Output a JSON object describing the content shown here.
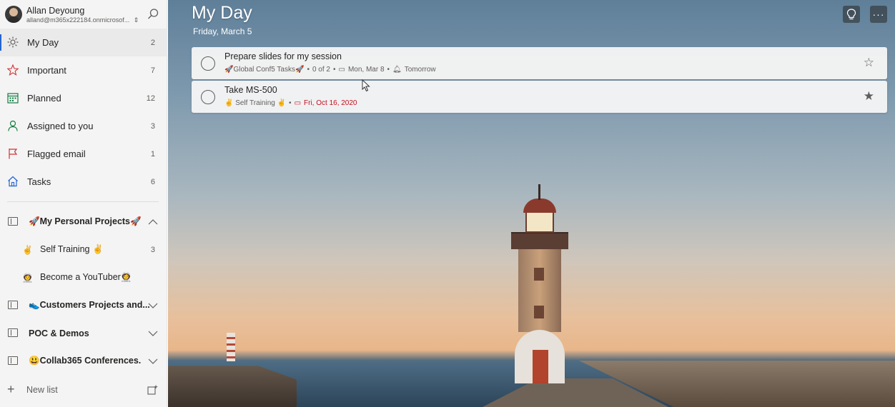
{
  "user": {
    "name": "Allan Deyoung",
    "email": "alland@m365x222184.onmicrosof..."
  },
  "nav": [
    {
      "label": "My Day",
      "count": "2",
      "icon": "sun-icon",
      "color": "#605e5c"
    },
    {
      "label": "Important",
      "count": "7",
      "icon": "star-icon",
      "color": "#d13438"
    },
    {
      "label": "Planned",
      "count": "12",
      "icon": "calendar-icon",
      "color": "#107c41"
    },
    {
      "label": "Assigned to you",
      "count": "3",
      "icon": "person-icon",
      "color": "#107c41"
    },
    {
      "label": "Flagged email",
      "count": "1",
      "icon": "flag-icon",
      "color": "#d13438"
    },
    {
      "label": "Tasks",
      "count": "6",
      "icon": "home-icon",
      "color": "#2564cf"
    }
  ],
  "groups": {
    "personal": {
      "label": "🚀My Personal Projects🚀",
      "lists": [
        {
          "icon": "✌",
          "label": "Self Training ✌",
          "count": "3"
        },
        {
          "icon": "👩‍🚀",
          "label": "Become a YouTuber👩‍🚀",
          "count": ""
        }
      ]
    },
    "customers": {
      "label": "👟Customers Projects and..."
    },
    "poc": {
      "label": "POC & Demos"
    },
    "collab": {
      "label": "😃Collab365 Conferences."
    }
  },
  "new_list_label": "New list",
  "main": {
    "title": "My Day",
    "date": "Friday, March 5"
  },
  "tasks": [
    {
      "title": "Prepare slides for my session",
      "list": "🚀Global Conf5 Tasks🚀",
      "steps": "0 of 2",
      "due": "Mon, Mar 8",
      "reminder": "Tomorrow",
      "starred": false
    },
    {
      "title": "Take MS-500",
      "list": "✌ Self Training ✌",
      "due": "Fri, Oct 16, 2020",
      "starred": true
    }
  ],
  "colors": {
    "accent": "#2564cf",
    "overdue": "#c50f1f"
  }
}
